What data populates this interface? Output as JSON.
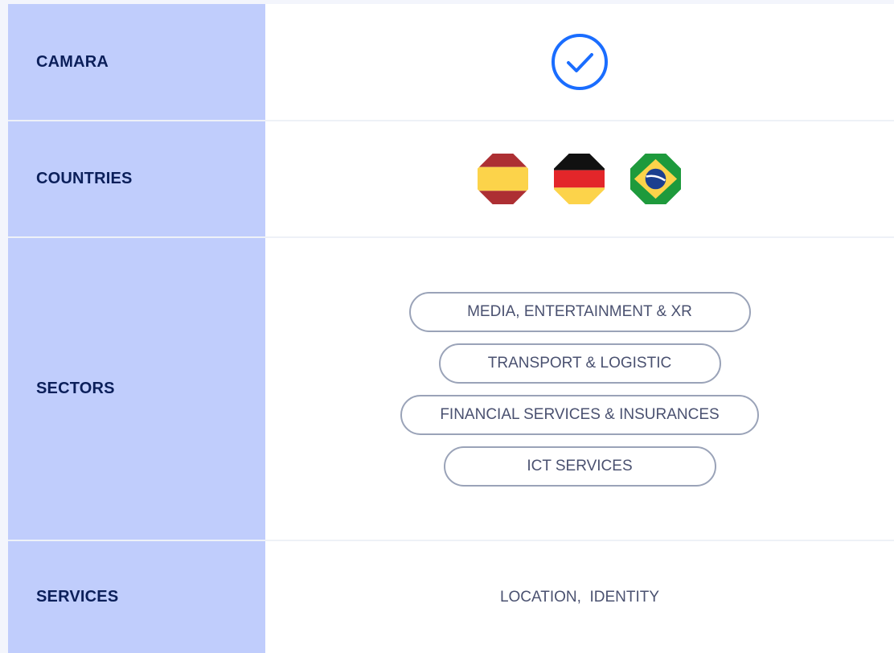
{
  "rows": {
    "camara": {
      "label": "CAMARA",
      "status_icon": "check-circle-icon",
      "accent": "#1a6dff"
    },
    "countries": {
      "label": "COUNTRIES",
      "flags": [
        {
          "icon": "spain-flag-icon"
        },
        {
          "icon": "germany-flag-icon"
        },
        {
          "icon": "brazil-flag-icon"
        }
      ]
    },
    "sectors": {
      "label": "SECTORS",
      "items": [
        "MEDIA, ENTERTAINMENT & XR",
        "TRANSPORT & LOGISTIC",
        "FINANCIAL SERVICES & INSURANCES",
        "ICT SERVICES"
      ]
    },
    "services": {
      "label": "SERVICES",
      "value": "LOCATION,  IDENTITY"
    }
  }
}
